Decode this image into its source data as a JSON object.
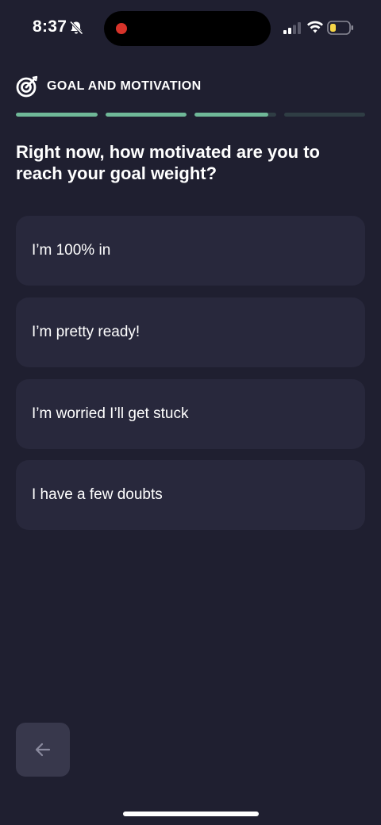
{
  "status_bar": {
    "time": "8:37",
    "icons": [
      "bell-slash-icon",
      "record-dot-icon",
      "signal-icon",
      "wifi-icon",
      "battery-icon"
    ],
    "battery_color": "#f5d547",
    "record_color": "#d7332a"
  },
  "header": {
    "icon": "target-icon",
    "title": "GOAL AND MOTIVATION"
  },
  "progress": {
    "segments": [
      1.0,
      1.0,
      0.9,
      0.0
    ],
    "fill_color": "#6fb898",
    "track_color": "#2f3d44"
  },
  "question": "Right now, how motivated are you to reach your goal weight?",
  "options": [
    {
      "label": "I’m 100% in"
    },
    {
      "label": "I’m pretty ready!"
    },
    {
      "label": "I’m worried I’ll get stuck"
    },
    {
      "label": "I have a few doubts"
    }
  ],
  "navigation": {
    "back_icon": "arrow-left-icon"
  },
  "colors": {
    "background": "#1f1f30",
    "option_background": "#28283c",
    "back_button_background": "#38384c"
  }
}
